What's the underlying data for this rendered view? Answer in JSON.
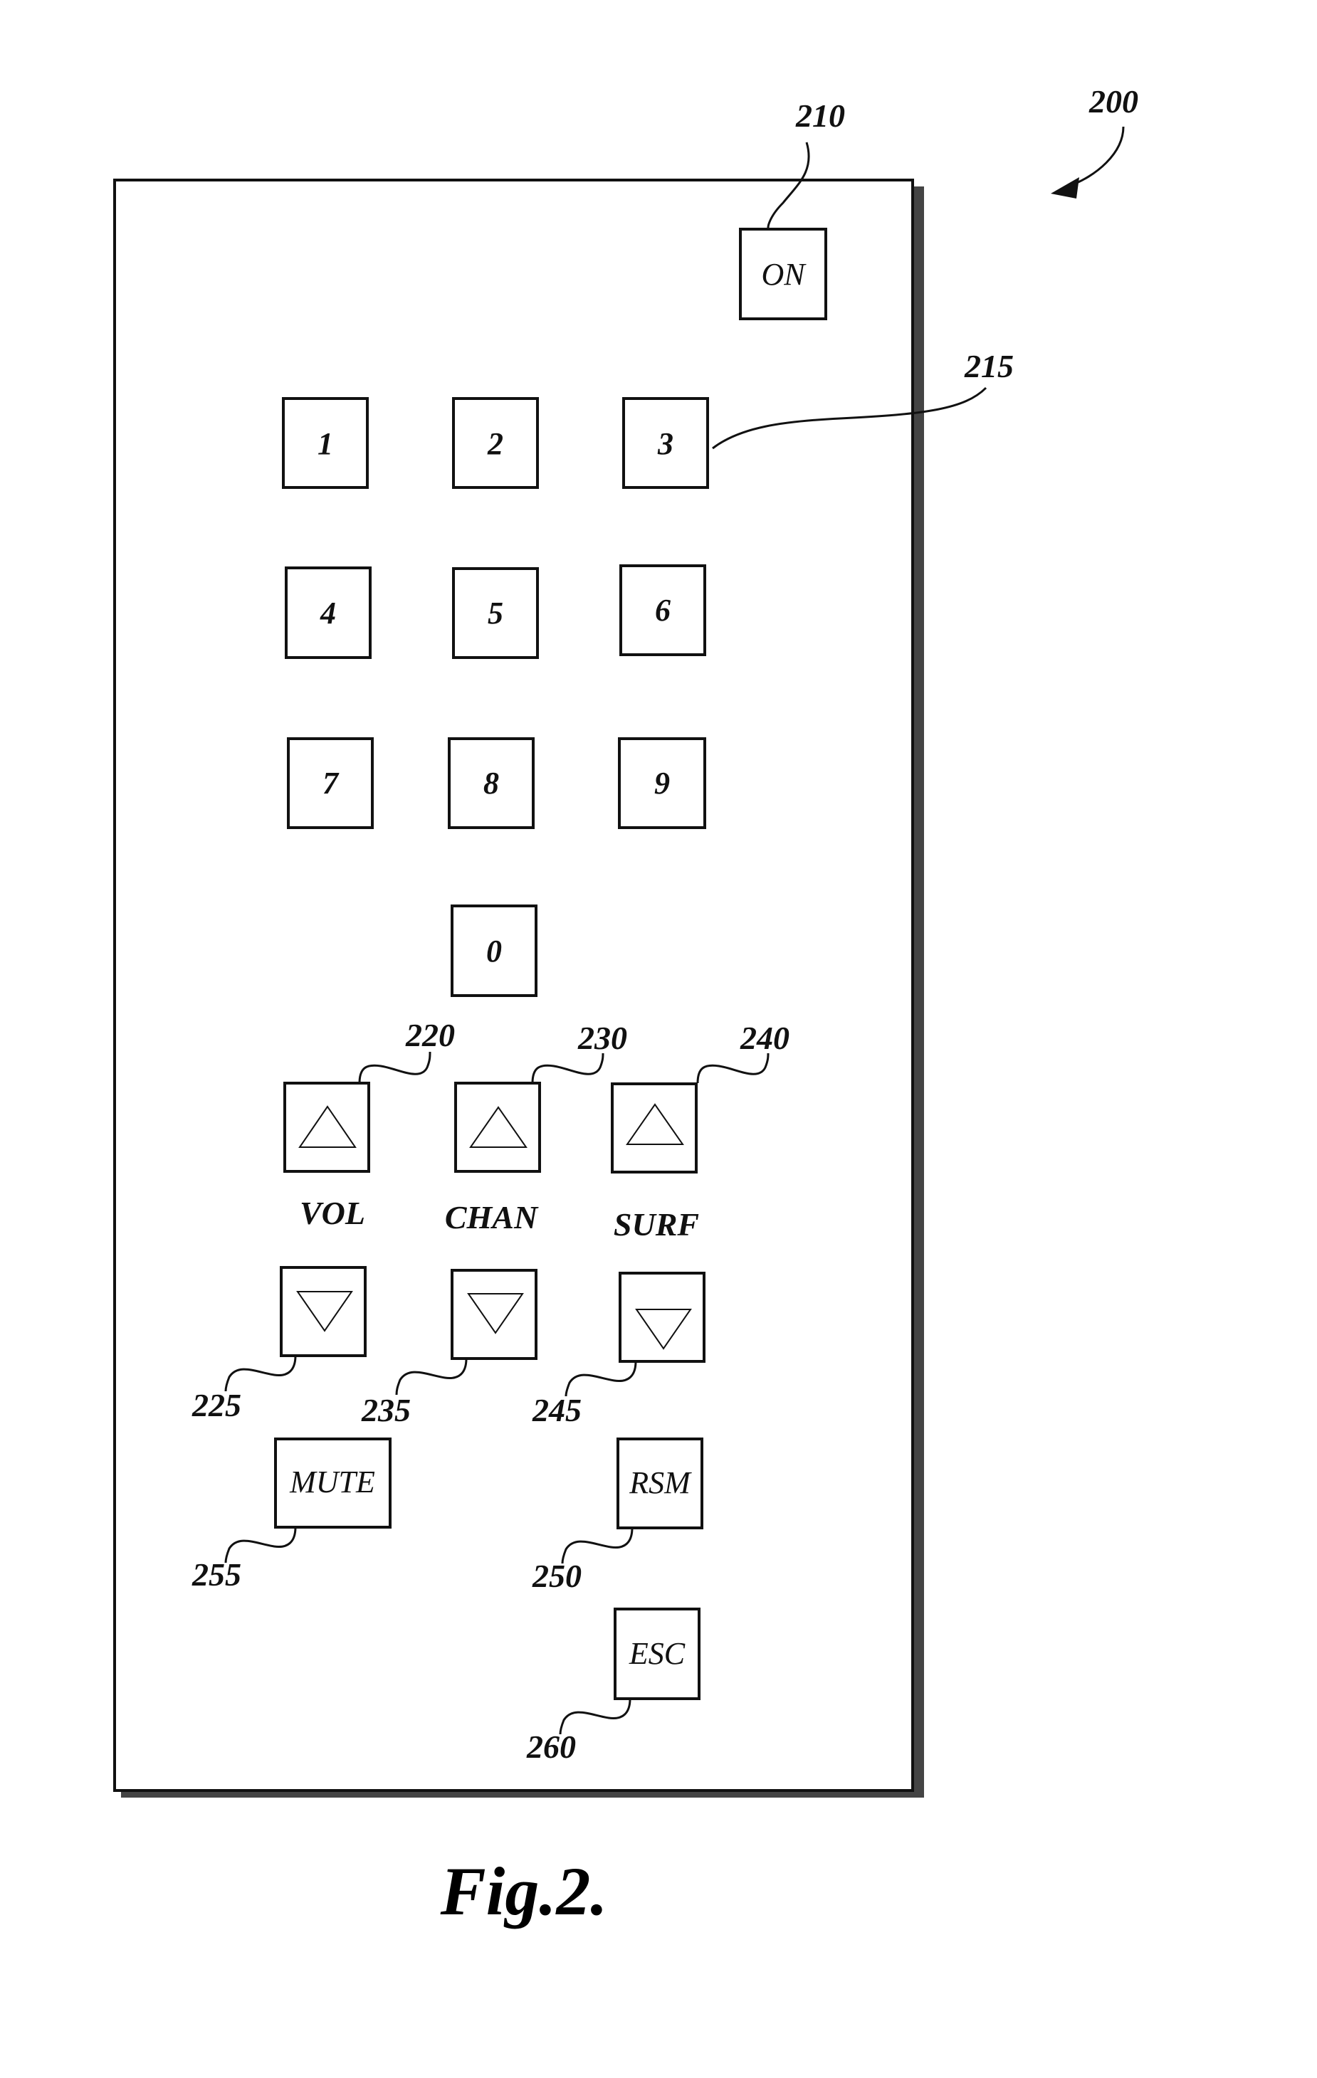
{
  "figure": {
    "caption": "Fig.2.",
    "device_ref": "200"
  },
  "keys": {
    "power": {
      "label": "ON",
      "ref": "210"
    },
    "digits": {
      "ref": "215",
      "labels": [
        "1",
        "2",
        "3",
        "4",
        "5",
        "6",
        "7",
        "8",
        "9",
        "0"
      ]
    },
    "volume": {
      "label": "VOL",
      "up_ref": "220",
      "down_ref": "225"
    },
    "channel": {
      "label": "CHAN",
      "up_ref": "230",
      "down_ref": "235"
    },
    "surf": {
      "label": "SURF",
      "up_ref": "240",
      "down_ref": "245"
    },
    "mute": {
      "label": "MUTE",
      "ref": "255"
    },
    "resume": {
      "label": "RSM",
      "ref": "250"
    },
    "escape": {
      "label": "ESC",
      "ref": "260"
    }
  },
  "icons": {
    "up": "triangle-up-outline",
    "down": "triangle-down-outline"
  },
  "colors": {
    "ink": "#111111",
    "paper": "#ffffff"
  }
}
